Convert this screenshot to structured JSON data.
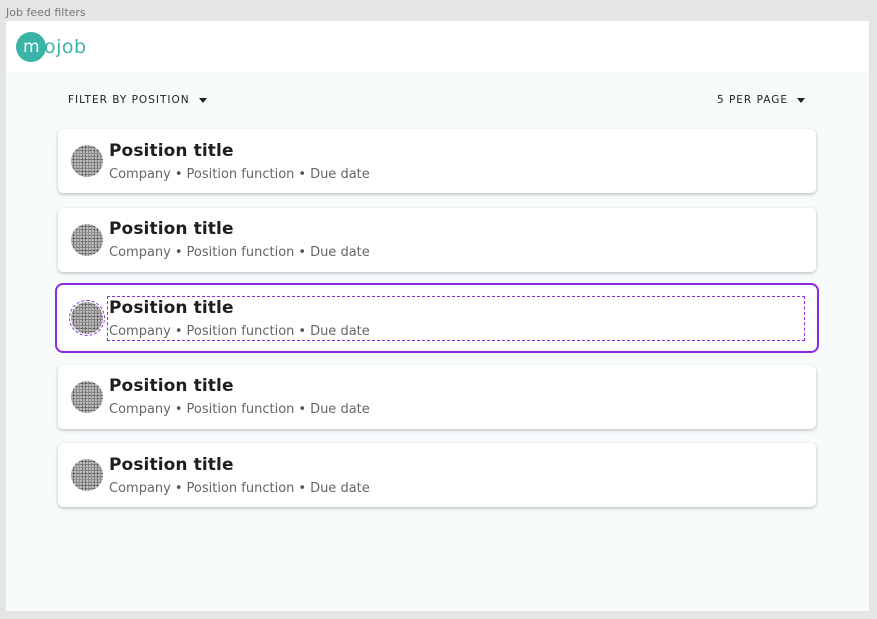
{
  "canvas": {
    "frame_label": "Job feed filters"
  },
  "brand": {
    "logo_mark": "m",
    "logo_rest": "ojob",
    "color": "#3bb4a8"
  },
  "filters": {
    "position_label": "FILTER BY POSITION",
    "per_page_label": "5 PER PAGE"
  },
  "colors": {
    "selection": "#8a2be2",
    "background": "#f7fbfc"
  },
  "jobs": [
    {
      "title": "Position title",
      "company": "Company",
      "function": "Position function",
      "due": "Due date",
      "selected": false
    },
    {
      "title": "Position title",
      "company": "Company",
      "function": "Position function",
      "due": "Due date",
      "selected": false
    },
    {
      "title": "Position title",
      "company": "Company",
      "function": "Position function",
      "due": "Due date",
      "selected": true
    },
    {
      "title": "Position title",
      "company": "Company",
      "function": "Position function",
      "due": "Due date",
      "selected": false
    },
    {
      "title": "Position title",
      "company": "Company",
      "function": "Position function",
      "due": "Due date",
      "selected": false
    }
  ]
}
